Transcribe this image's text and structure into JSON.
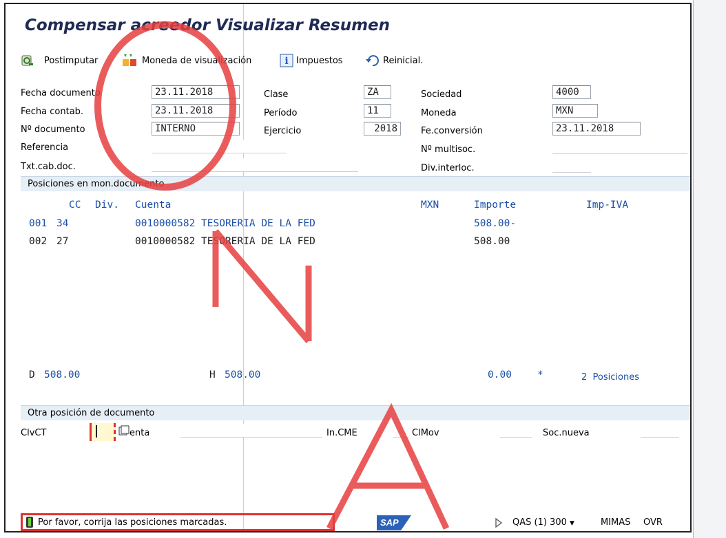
{
  "window": {
    "title": "Compensar acreedor Visualizar Resumen"
  },
  "toolbar": {
    "postimputar": "Postimputar",
    "moneda": "Moneda de visualización",
    "impuestos": "Impuestos",
    "reinicial": "Reinicial."
  },
  "header": {
    "fecha_documento": {
      "label": "Fecha documento",
      "value": "23.11.2018"
    },
    "fecha_contab": {
      "label": "Fecha contab.",
      "value": "23.11.2018"
    },
    "no_documento": {
      "label": "Nº documento",
      "value": "INTERNO"
    },
    "referencia": {
      "label": "Referencia",
      "value": ""
    },
    "txt_cab_doc": {
      "label": "Txt.cab.doc.",
      "value": ""
    },
    "clase": {
      "label": "Clase",
      "value": "ZA"
    },
    "periodo": {
      "label": "Período",
      "value": "11"
    },
    "ejercicio": {
      "label": "Ejercicio",
      "value": "2018"
    },
    "sociedad": {
      "label": "Sociedad",
      "value": "4000"
    },
    "moneda": {
      "label": "Moneda",
      "value": "MXN"
    },
    "fe_conversion": {
      "label": "Fe.conversión",
      "value": "23.11.2018"
    },
    "no_multisoc": {
      "label": "Nº multisoc.",
      "value": ""
    },
    "div_interloc": {
      "label": "Div.interloc.",
      "value": ""
    }
  },
  "positions": {
    "section_title": "Posiciones en mon.documento",
    "columns": {
      "cc": "CC",
      "div": "Div.",
      "cuenta": "Cuenta",
      "mxn": "MXN",
      "importe": "Importe",
      "imp_iva": "Imp-IVA"
    },
    "rows": [
      {
        "pos": "001",
        "cc": "34",
        "cuenta": "0010000582 TESORERIA DE LA FED",
        "importe": "508.00-"
      },
      {
        "pos": "002",
        "cc": "27",
        "cuenta": "0010000582 TESORERIA DE LA FED",
        "importe": "508.00"
      }
    ],
    "totals": {
      "d_label": "D",
      "d_value": "508.00",
      "h_label": "H",
      "h_value": "508.00",
      "diff": "0.00",
      "diff_marker": "*",
      "count": "2",
      "count_label": "Posiciones"
    }
  },
  "otra_posicion": {
    "section_title": "Otra posición de documento",
    "clvct_label": "ClvCT",
    "clvct_value": "",
    "cuenta_label": "enta",
    "in_cme_label": "In.CME",
    "clmov_label": "ClMov",
    "soc_nueva_label": "Soc.nueva"
  },
  "status": {
    "message": "Por favor, corrija las posiciones marcadas.",
    "sap_logo": "SAP",
    "system": "QAS (1) 300",
    "server": "MIMAS",
    "mode": "OVR"
  },
  "colors": {
    "blue_text": "#1b4fa8",
    "section_bg": "#e6eef6",
    "error_border": "#e03030",
    "watermark": "#e64040"
  }
}
